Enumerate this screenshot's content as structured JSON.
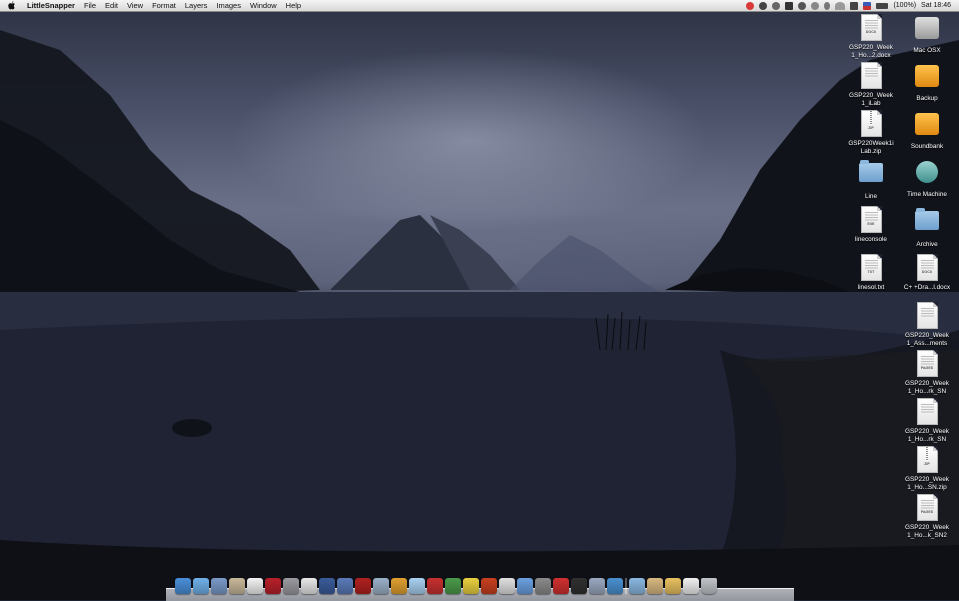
{
  "menubar": {
    "apple_icon": "apple-logo-icon",
    "app_name": "LittleSnapper",
    "menus": [
      "File",
      "Edit",
      "View",
      "Format",
      "Layers",
      "Images",
      "Window",
      "Help"
    ],
    "battery": "(100%)",
    "clock": "Sat 18:46"
  },
  "desktop_icons": [
    {
      "label": "GSP220_Week 1_Ho...2.docx",
      "kind": "doc",
      "tag": "DOCX"
    },
    {
      "label": "Mac OSX",
      "kind": "drive-silver",
      "tag": ""
    },
    {
      "label": "GSP220_Week 1_iLab",
      "kind": "doc",
      "tag": ""
    },
    {
      "label": "Backup",
      "kind": "drive-orange",
      "tag": ""
    },
    {
      "label": "GSP220Week1i Lab.zip",
      "kind": "zip",
      "tag": "ZIP"
    },
    {
      "label": "Soundbank",
      "kind": "drive-orange",
      "tag": ""
    },
    {
      "label": "Line",
      "kind": "folder",
      "tag": ""
    },
    {
      "label": "Time Machine",
      "kind": "drive-tm",
      "tag": ""
    },
    {
      "label": "lineconsole",
      "kind": "doc",
      "tag": "EXE"
    },
    {
      "label": "Archive",
      "kind": "folder",
      "tag": ""
    },
    {
      "label": "linesol.txt",
      "kind": "doc",
      "tag": "TXT"
    },
    {
      "label": "C+ +Dra...l.docx",
      "kind": "doc",
      "tag": "DOCX"
    },
    {
      "label": "GSP220_Week 1_Ass...ments",
      "kind": "doc",
      "tag": ""
    },
    {
      "label": "GSP220_Week 1_Ho...rk_SN",
      "kind": "doc",
      "tag": "PAGES"
    },
    {
      "label": "GSP220_Week 1_Ho...rk_SN",
      "kind": "doc",
      "tag": ""
    },
    {
      "label": "GSP220_Week 1_Ho...SN.zip",
      "kind": "zip",
      "tag": "ZIP"
    },
    {
      "label": "GSP220_Week 1_Ho...k_SN2",
      "kind": "doc",
      "tag": "PAGES"
    }
  ],
  "dock": {
    "items": [
      {
        "name": "finder",
        "color": "#4a8fd8"
      },
      {
        "name": "safari",
        "color": "#6fb0e8"
      },
      {
        "name": "preview",
        "color": "#7a9ac8"
      },
      {
        "name": "mail",
        "color": "#c8b89a"
      },
      {
        "name": "ical",
        "color": "#f2f2f2"
      },
      {
        "name": "photo-booth",
        "color": "#b8202a"
      },
      {
        "name": "system-preferences",
        "color": "#9a9aa0"
      },
      {
        "name": "textedit",
        "color": "#e8e8e8"
      },
      {
        "name": "xcode",
        "color": "#3a5c9a"
      },
      {
        "name": "instruments",
        "color": "#5a7ab8"
      },
      {
        "name": "sandvox",
        "color": "#b02020"
      },
      {
        "name": "script-editor",
        "color": "#9ab0c8"
      },
      {
        "name": "coda",
        "color": "#e0a030"
      },
      {
        "name": "cube",
        "color": "#a8d0f0"
      },
      {
        "name": "bbedit",
        "color": "#c83030"
      },
      {
        "name": "utilities",
        "color": "#4a9a4a"
      },
      {
        "name": "wand",
        "color": "#e8d040"
      },
      {
        "name": "vmware",
        "color": "#c84020"
      },
      {
        "name": "unity",
        "color": "#e0e0e0"
      },
      {
        "name": "itunes",
        "color": "#6aa0e0"
      },
      {
        "name": "chess",
        "color": "#8a8a8a"
      },
      {
        "name": "fantastical",
        "color": "#d03030"
      },
      {
        "name": "dvd-player",
        "color": "#303030"
      },
      {
        "name": "automator",
        "color": "#9aa8c0"
      },
      {
        "name": "little-snapper",
        "color": "#4a90d0"
      },
      {
        "name": "applications-folder",
        "color": "#8ab8e0"
      },
      {
        "name": "downloads-stack",
        "color": "#d8b880"
      },
      {
        "name": "documents-stack",
        "color": "#e8c060"
      },
      {
        "name": "pdf-stack",
        "color": "#f0f0f0"
      },
      {
        "name": "trash",
        "color": "#c0c4c8"
      }
    ]
  }
}
